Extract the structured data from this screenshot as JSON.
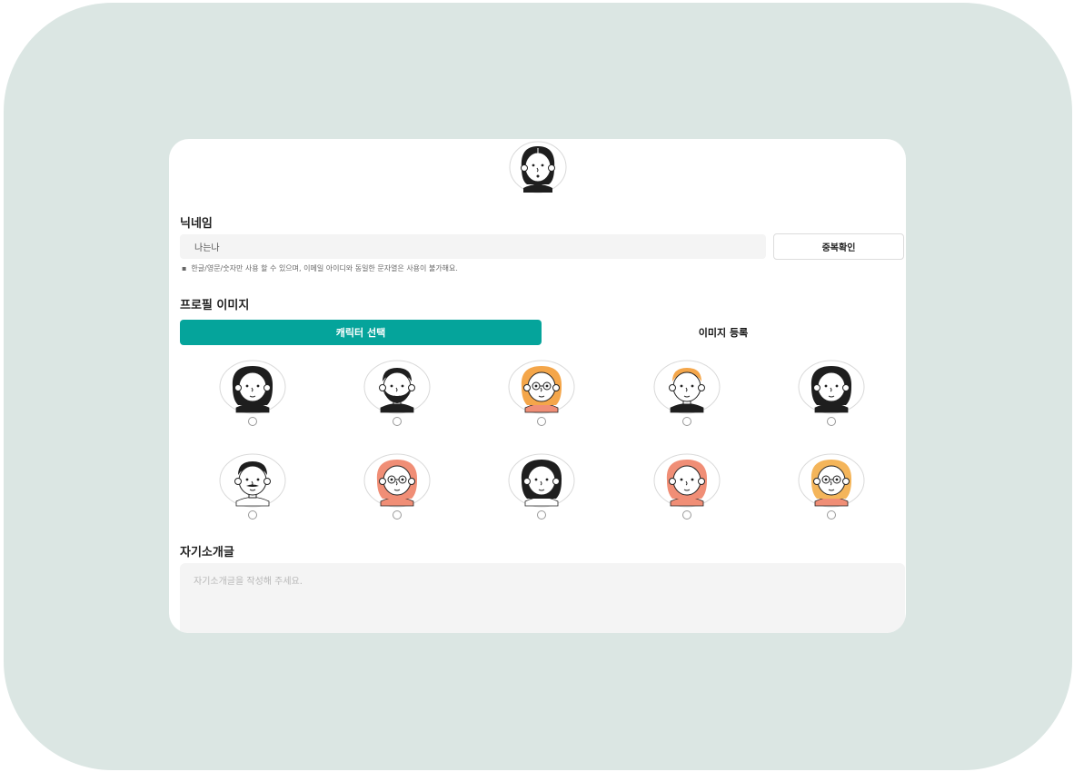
{
  "nickname": {
    "label": "닉네임",
    "value": "나는나",
    "check_button": "중복확인",
    "hint": "한글/영문/숫자만 사용 할 수 있으며, 이메일 아이디와 동일한 문자열은 사용이 불가해요."
  },
  "profile_image": {
    "label": "프로필 이미지",
    "tabs": {
      "character": "캐릭터 선택",
      "upload": "이미지 등록"
    },
    "active_tab": "character",
    "characters": [
      {
        "icon": "woman-black-hair-avatar-icon",
        "hair": "#1e1e1e",
        "skin": "#ffffff",
        "shirt": "#1e1e1e",
        "selected": false
      },
      {
        "icon": "bearded-man-avatar-icon",
        "hair": "#1e1e1e",
        "skin": "#ffffff",
        "shirt": "#1e1e1e",
        "selected": false
      },
      {
        "icon": "curly-orange-hair-avatar-icon",
        "hair": "#f4a64a",
        "skin": "#ffffff",
        "shirt": "#f08e76",
        "selected": false
      },
      {
        "icon": "blonde-man-avatar-icon",
        "hair": "#f4a64a",
        "skin": "#ffffff",
        "shirt": "#1e1e1e",
        "selected": false
      },
      {
        "icon": "woman-black-hair-avatar-icon",
        "hair": "#1e1e1e",
        "skin": "#ffffff",
        "shirt": "#1e1e1e",
        "selected": false
      },
      {
        "icon": "mustache-man-avatar-icon",
        "hair": "#1e1e1e",
        "skin": "#ffffff",
        "shirt": "#ffffff",
        "selected": false
      },
      {
        "icon": "pink-long-hair-avatar-icon",
        "hair": "#f08e76",
        "skin": "#ffffff",
        "shirt": "#f08e76",
        "selected": false
      },
      {
        "icon": "bun-hair-woman-avatar-icon",
        "hair": "#1e1e1e",
        "skin": "#ffffff",
        "shirt": "#ffffff",
        "selected": false
      },
      {
        "icon": "pink-updo-woman-avatar-icon",
        "hair": "#f08e76",
        "skin": "#ffffff",
        "shirt": "#f08e76",
        "selected": false
      },
      {
        "icon": "blonde-woman-glasses-avatar-icon",
        "hair": "#f4b55a",
        "skin": "#ffffff",
        "shirt": "#f08e76",
        "selected": false
      }
    ]
  },
  "bio": {
    "label": "자기소개글",
    "placeholder": "자기소개글을 작성해 주세요."
  },
  "colors": {
    "accent": "#05a49b",
    "backdrop": "#dbe6e3",
    "input_bg": "#f4f4f4"
  }
}
